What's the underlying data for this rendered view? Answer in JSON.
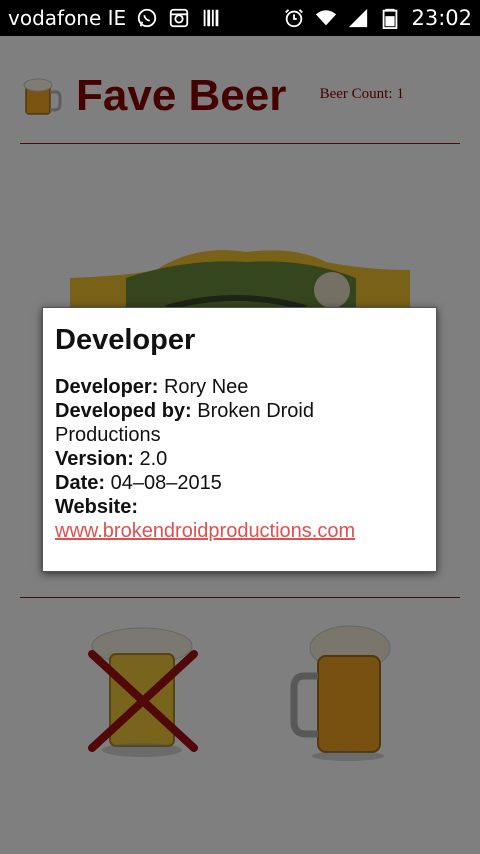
{
  "status_bar": {
    "carrier": "vodafone IE",
    "time": "23:02",
    "icons": [
      "whatsapp-icon",
      "instagram-icon",
      "barcode-icon",
      "alarm-icon",
      "wifi-icon",
      "signal-icon",
      "battery-icon"
    ]
  },
  "header": {
    "title": "Fave Beer",
    "beer_count_label": "Beer Count:",
    "beer_count_value": "1"
  },
  "actions": {
    "left_icon": "beer-crossed-icon",
    "right_icon": "beer-mug-icon"
  },
  "dialog": {
    "title": "Developer",
    "developer_label": "Developer:",
    "developer_value": "Rory Nee",
    "developed_by_label": "Developed by:",
    "developed_by_value": "Broken Droid Productions",
    "version_label": "Version:",
    "version_value": "2.0",
    "date_label": "Date:",
    "date_value": "04–08–2015",
    "website_label": "Website:",
    "website_value": "www.brokendroidproductions.com"
  },
  "colors": {
    "brand": "#8b0000",
    "link": "#e05050"
  }
}
